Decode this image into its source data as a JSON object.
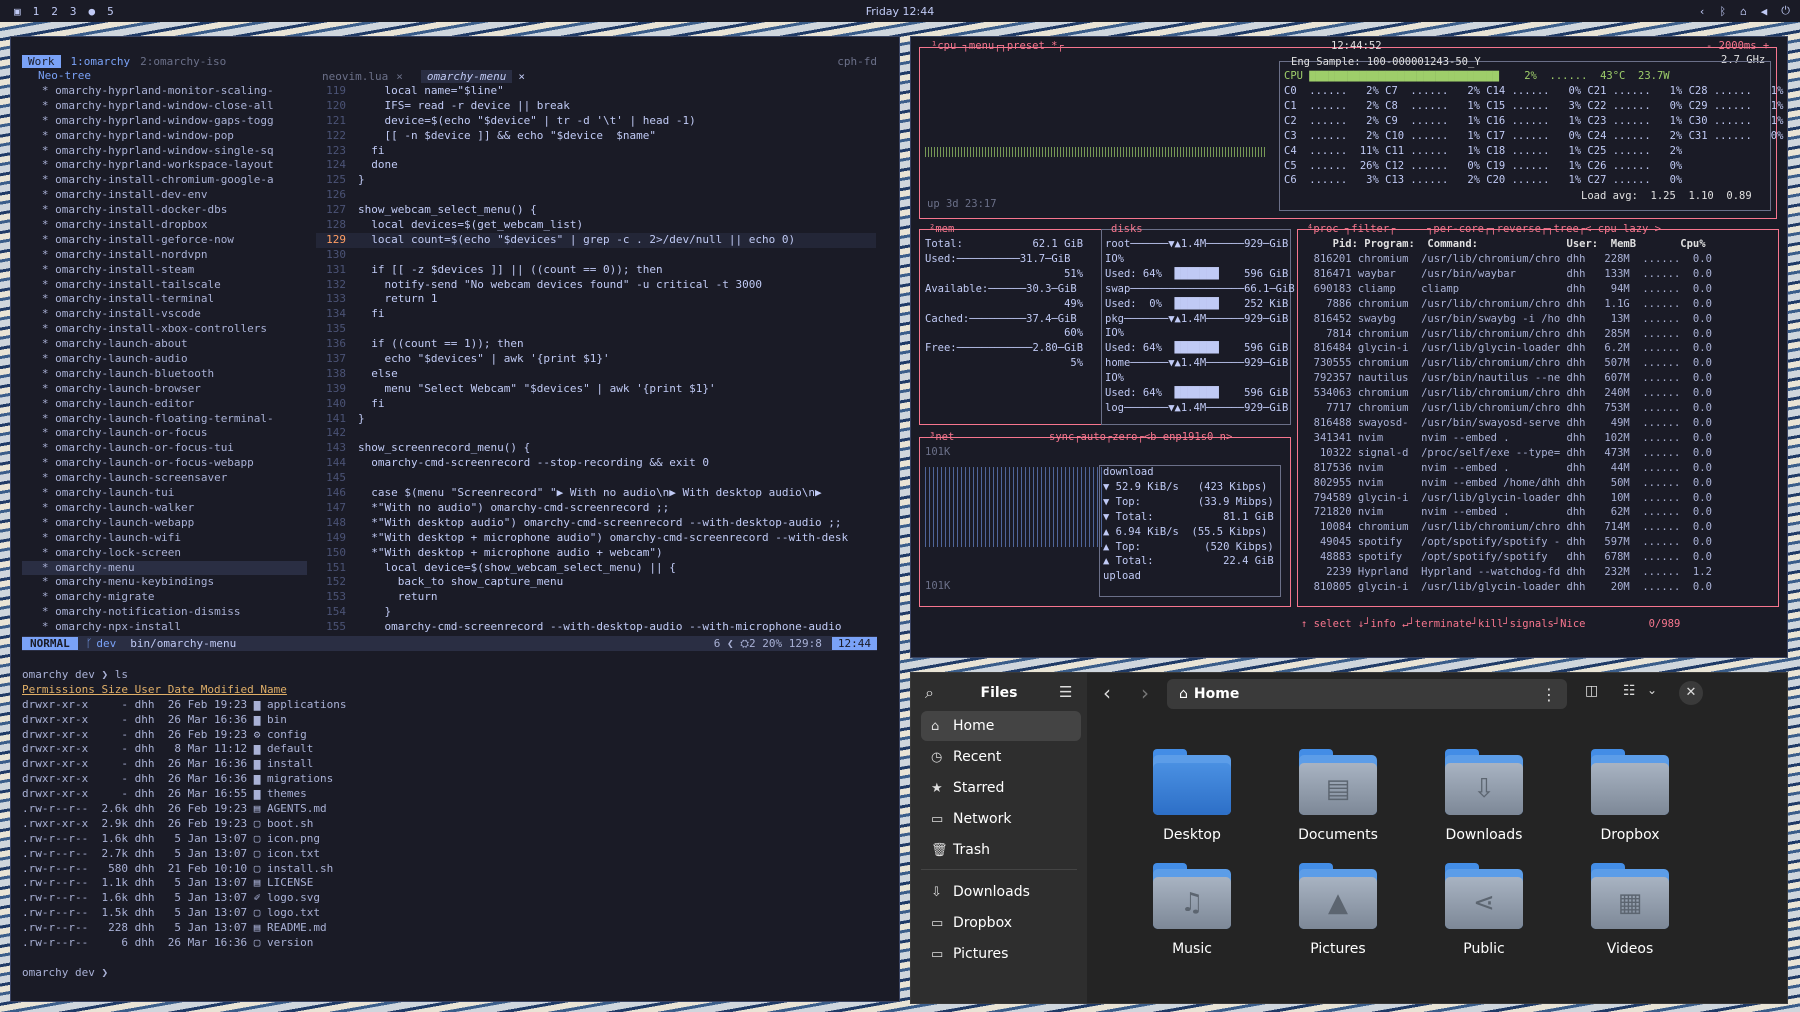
{
  "topbar": {
    "workspaces": [
      "1",
      "2",
      "3",
      "●",
      "5"
    ],
    "clock": "Friday 12:44"
  },
  "nvim": {
    "tree_title": "Neo-tree",
    "badge": "Work",
    "tmux_tabs": [
      "1:omarchy",
      "2:omarchy-iso"
    ],
    "host": "cph-fd",
    "buffers": [
      "neovim.lua",
      "omarchy-menu"
    ],
    "tree": [
      "omarchy-hyprland-monitor-scaling-",
      "omarchy-hyprland-window-close-all",
      "omarchy-hyprland-window-gaps-togg",
      "omarchy-hyprland-window-pop",
      "omarchy-hyprland-window-single-sq",
      "omarchy-hyprland-workspace-layout",
      "omarchy-install-chromium-google-a",
      "omarchy-install-dev-env",
      "omarchy-install-docker-dbs",
      "omarchy-install-dropbox",
      "omarchy-install-geforce-now",
      "omarchy-install-nordvpn",
      "omarchy-install-steam",
      "omarchy-install-tailscale",
      "omarchy-install-terminal",
      "omarchy-install-vscode",
      "omarchy-install-xbox-controllers",
      "omarchy-launch-about",
      "omarchy-launch-audio",
      "omarchy-launch-bluetooth",
      "omarchy-launch-browser",
      "omarchy-launch-editor",
      "omarchy-launch-floating-terminal-",
      "omarchy-launch-or-focus",
      "omarchy-launch-or-focus-tui",
      "omarchy-launch-or-focus-webapp",
      "omarchy-launch-screensaver",
      "omarchy-launch-tui",
      "omarchy-launch-walker",
      "omarchy-launch-webapp",
      "omarchy-launch-wifi",
      "omarchy-lock-screen",
      "omarchy-menu",
      "omarchy-menu-keybindings",
      "omarchy-migrate",
      "omarchy-notification-dismiss",
      "omarchy-npx-install"
    ],
    "code": [
      [
        "119",
        "    local name=\"$line\""
      ],
      [
        "120",
        "    IFS= read -r device || break"
      ],
      [
        "121",
        "    device=$(echo \"$device\" | tr -d '\\t' | head -1)"
      ],
      [
        "122",
        "    [[ -n $device ]] && echo \"$device  $name\""
      ],
      [
        "123",
        "  fi"
      ],
      [
        "124",
        "  done"
      ],
      [
        "125",
        "}"
      ],
      [
        "126",
        ""
      ],
      [
        "127",
        "show_webcam_select_menu() {"
      ],
      [
        "128",
        "  local devices=$(get_webcam_list)"
      ],
      [
        "129",
        "  local count=$(echo \"$devices\" | grep -c . 2>/dev/null || echo 0)"
      ],
      [
        "130",
        ""
      ],
      [
        "131",
        "  if [[ -z $devices ]] || ((count == 0)); then"
      ],
      [
        "132",
        "    notify-send \"No webcam devices found\" -u critical -t 3000"
      ],
      [
        "133",
        "    return 1"
      ],
      [
        "134",
        "  fi"
      ],
      [
        "135",
        ""
      ],
      [
        "136",
        "  if ((count == 1)); then"
      ],
      [
        "137",
        "    echo \"$devices\" | awk '{print $1}'"
      ],
      [
        "138",
        "  else"
      ],
      [
        "139",
        "    menu \"Select Webcam\" \"$devices\" | awk '{print $1}'"
      ],
      [
        "140",
        "  fi"
      ],
      [
        "141",
        "}"
      ],
      [
        "142",
        ""
      ],
      [
        "143",
        "show_screenrecord_menu() {"
      ],
      [
        "144",
        "  omarchy-cmd-screenrecord --stop-recording && exit 0"
      ],
      [
        "145",
        ""
      ],
      [
        "146",
        "  case $(menu \"Screenrecord\" \"▶ With no audio\\n▶ With desktop audio\\n▶"
      ],
      [
        "147",
        "  *\"With no audio\") omarchy-cmd-screenrecord ;;"
      ],
      [
        "148",
        "  *\"With desktop audio\") omarchy-cmd-screenrecord --with-desktop-audio ;;"
      ],
      [
        "149",
        "  *\"With desktop + microphone audio\") omarchy-cmd-screenrecord --with-desk"
      ],
      [
        "150",
        "  *\"With desktop + microphone audio + webcam\")"
      ],
      [
        "151",
        "    local device=$(show_webcam_select_menu) || {"
      ],
      [
        "152",
        "      back_to show_capture_menu"
      ],
      [
        "153",
        "      return"
      ],
      [
        "154",
        "    }"
      ],
      [
        "155",
        "    omarchy-cmd-screenrecord --with-desktop-audio --with-microphone-audio"
      ]
    ],
    "status": {
      "mode": "NORMAL",
      "branch": "dev",
      "path": "bin/omarchy-menu",
      "right": "6 ❮ ⛭2   20%  129:8",
      "time": "12:44"
    },
    "terminal": {
      "prompt1": "omarchy dev ❯ ls",
      "header": "Permissions Size User Date Modified Name",
      "rows": [
        "drwxr-xr-x     - dhh  26 Feb 19:23 ▆ applications",
        "drwxr-xr-x     - dhh  26 Mar 16:36 ▆ bin",
        "drwxr-xr-x     - dhh  26 Feb 19:23 ⚙ config",
        "drwxr-xr-x     - dhh   8 Mar 11:12 ▆ default",
        "drwxr-xr-x     - dhh  26 Mar 16:36 ▆ install",
        "drwxr-xr-x     - dhh  26 Mar 16:36 ▆ migrations",
        "drwxr-xr-x     - dhh  26 Mar 16:55 ▆ themes",
        ".rw-r--r--  2.6k dhh  26 Feb 19:23 ▤ AGENTS.md",
        ".rwxr-xr-x  2.9k dhh  26 Feb 19:23 ▢ boot.sh",
        ".rw-r--r--  1.6k dhh   5 Jan 13:07 ▢ icon.png",
        ".rw-r--r--  2.7k dhh   5 Jan 13:07 ▢ icon.txt",
        ".rw-r--r--   580 dhh  21 Feb 10:10 ▢ install.sh",
        ".rw-r--r--  1.1k dhh   5 Jan 13:07 ▤ LICENSE",
        ".rw-r--r--  1.6k dhh   5 Jan 13:07 ✐ logo.svg",
        ".rw-r--r--  1.5k dhh   5 Jan 13:07 ▢ logo.txt",
        ".rw-r--r--   228 dhh   5 Jan 13:07 ▤ README.md",
        ".rw-r--r--     6 dhh  26 Mar 16:36 ▢ version"
      ],
      "prompt2": "omarchy dev ❯"
    }
  },
  "btop": {
    "cpu_title": "¹cpu ┐menu┌┐preset *┌",
    "time": "12:44:52",
    "interval": "- 2000ms +",
    "freq": "2.7 GHz",
    "sample": "Eng Sample: 100-000001243-50_Y",
    "cpu_total": "CPU ▇▇▇▇▇▇▇▇▇▇▇▇▇▇▇▇▇▇▇▇▇▇▇▇▇▇▇▇▇▇    2%  ......  43°C  23.7W",
    "cores": [
      "C0  ......   2% C7  ......   2% C14 ......   0% C21 ......   1% C28 ......   1%",
      "C1  ......   2% C8  ......   1% C15 ......   3% C22 ......   0% C29 ......   1%",
      "C2  ......   2% C9  ......   1% C16 ......   1% C23 ......   1% C30 ......   1%",
      "C3  ......   2% C10 ......   1% C17 ......   0% C24 ......   2% C31 ......   0%",
      "C4  ......  11% C11 ......   1% C18 ......   1% C25 ......   2%",
      "C5  ......  26% C12 ......   0% C19 ......   1% C26 ......   0%",
      "C6  ......   3% C13 ......   2% C20 ......   1% C27 ......   0%"
    ],
    "load": "Load avg:  1.25  1.10  0.89",
    "uptime": "up 3d 23:17",
    "mem": [
      "Total:           62.1 GiB",
      "Used:──────────31.7─GiB",
      "                      51%",
      "Available:──────30.3─GiB",
      "                      49%",
      "Cached:─────────37.4─GiB",
      "                      60%",
      "Free:────────────2.80─GiB",
      "                       5%"
    ],
    "disks": [
      "root──────▼▲1.4M──────929─GiB",
      "IO%",
      "Used: 64%  ███████    596 GiB",
      "swap──────────────────66.1─GiB",
      "Used:  0%  ███████    252 KiB",
      "pkg───────▼▲1.4M──────929─GiB",
      "IO%",
      "Used: 64%  ███████    596 GiB",
      "home──────▼▲1.4M──────929─GiB",
      "IO%",
      "Used: 64%  ███████    596 GiB",
      "log───────▼▲1.4M──────929─GiB"
    ],
    "net_title": "³net",
    "net_opts": "sync┌auto┌zero┌<b enp191s0 n>",
    "net": [
      "download",
      "▼ 52.9 KiB/s   (423 Kibps)",
      "▼ Top:         (33.9 Mibps)",
      "▼ Total:           81.1 GiB",
      "",
      "▲ 6.94 KiB/s  (55.5 Kibps)",
      "▲ Top:          (520 Kibps)",
      "▲ Total:           22.4 GiB",
      "upload"
    ],
    "net_scale": [
      "101K",
      "101K"
    ],
    "proc_title": "⁴proc ┐filter┌     ┐per-core┌┐reverse┌┐tree┌< cpu lazy >",
    "proc_header": "     Pid: Program:  Command:              User:  MemB       Cpu%",
    "procs": [
      "  816201 chromium  /usr/lib/chromium/chro dhh   228M  ......  0.0",
      "  816471 waybar    /usr/bin/waybar        dhh   133M  ......  0.0",
      "  690183 cliamp    cliamp                 dhh    94M  ......  0.0",
      "    7886 chromium  /usr/lib/chromium/chro dhh   1.1G  ......  0.0",
      "  816452 swaybg    /usr/bin/swaybg -i /ho dhh    13M  ......  0.0",
      "    7814 chromium  /usr/lib/chromium/chro dhh   285M  ......  0.0",
      "  816484 glycin-i  /usr/lib/glycin-loader dhh   6.2M  ......  0.0",
      "  730555 chromium  /usr/lib/chromium/chro dhh   507M  ......  0.0",
      "  792357 nautilus  /usr/bin/nautilus --ne dhh   607M  ......  0.0",
      "  534063 chromium  /usr/lib/chromium/chro dhh   240M  ......  0.0",
      "    7717 chromium  /usr/lib/chromium/chro dhh   753M  ......  0.0",
      "  816488 swayosd-  /usr/bin/swayosd-serve dhh    49M  ......  0.0",
      "  341341 nvim      nvim --embed .         dhh   102M  ......  0.0",
      "   10322 signal-d  /proc/self/exe --type= dhh   473M  ......  0.0",
      "  817536 nvim      nvim --embed .         dhh    44M  ......  0.0",
      "  802955 nvim      nvim --embed /home/dhh dhh    50M  ......  0.0",
      "  794589 glycin-i  /usr/lib/glycin-loader dhh    10M  ......  0.0",
      "  721820 nvim      nvim --embed .         dhh    62M  ......  0.0",
      "   10084 chromium  /usr/lib/chromium/chro dhh   714M  ......  0.0",
      "   49045 spotify   /opt/spotify/spotify - dhh   597M  ......  0.0",
      "   48883 spotify   /opt/spotify/spotify   dhh   678M  ......  0.0",
      "    2239 Hyprland  Hyprland --watchdog-fd dhh   232M  ......  1.2",
      "  810805 glycin-i  /usr/lib/glycin-loader dhh    20M  ......  0.0"
    ],
    "proc_footer": "↑ select ↓┘info ↵┘terminate┘kill┘signals┘Nice          0/989"
  },
  "files": {
    "title": "Files",
    "location": "Home",
    "sidebar": [
      {
        "icon": "⌂",
        "label": "Home"
      },
      {
        "icon": "◷",
        "label": "Recent"
      },
      {
        "icon": "★",
        "label": "Starred"
      },
      {
        "icon": "▭",
        "label": "Network"
      },
      {
        "icon": "🗑",
        "label": "Trash"
      },
      {
        "icon": "⇩",
        "label": "Downloads"
      },
      {
        "icon": "▭",
        "label": "Dropbox"
      },
      {
        "icon": "▭",
        "label": "Pictures"
      }
    ],
    "folders": [
      {
        "label": "Desktop",
        "glyph": ""
      },
      {
        "label": "Documents",
        "glyph": "▤"
      },
      {
        "label": "Downloads",
        "glyph": "⇩"
      },
      {
        "label": "Dropbox",
        "glyph": ""
      },
      {
        "label": "Music",
        "glyph": "♫"
      },
      {
        "label": "Pictures",
        "glyph": "▲"
      },
      {
        "label": "Public",
        "glyph": "⋖"
      },
      {
        "label": "Videos",
        "glyph": "▦"
      }
    ]
  }
}
